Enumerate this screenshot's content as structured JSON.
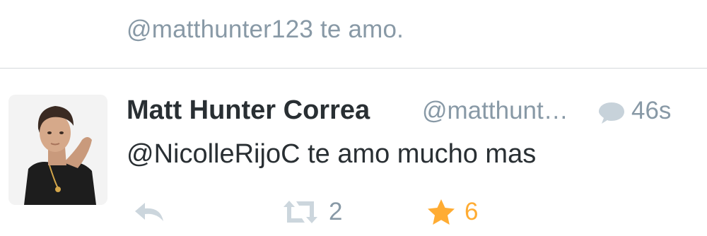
{
  "previous_tweet": {
    "text": "@matthunter123 te amo."
  },
  "tweet": {
    "author_name": "Matt Hunter Correa",
    "handle": "@matthunt…",
    "timestamp": "46s",
    "text": "@NicolleRijoC te amo mucho mas",
    "icons": {
      "conversation": "speech-bubble-icon",
      "reply": "reply-arrow-icon",
      "retweet": "retweet-icon",
      "favorite": "star-icon"
    },
    "retweet_count": "2",
    "favorite_count": "6",
    "colors": {
      "favorite_active": "#ffac33",
      "muted": "#8899a6",
      "text": "#292f33"
    }
  }
}
